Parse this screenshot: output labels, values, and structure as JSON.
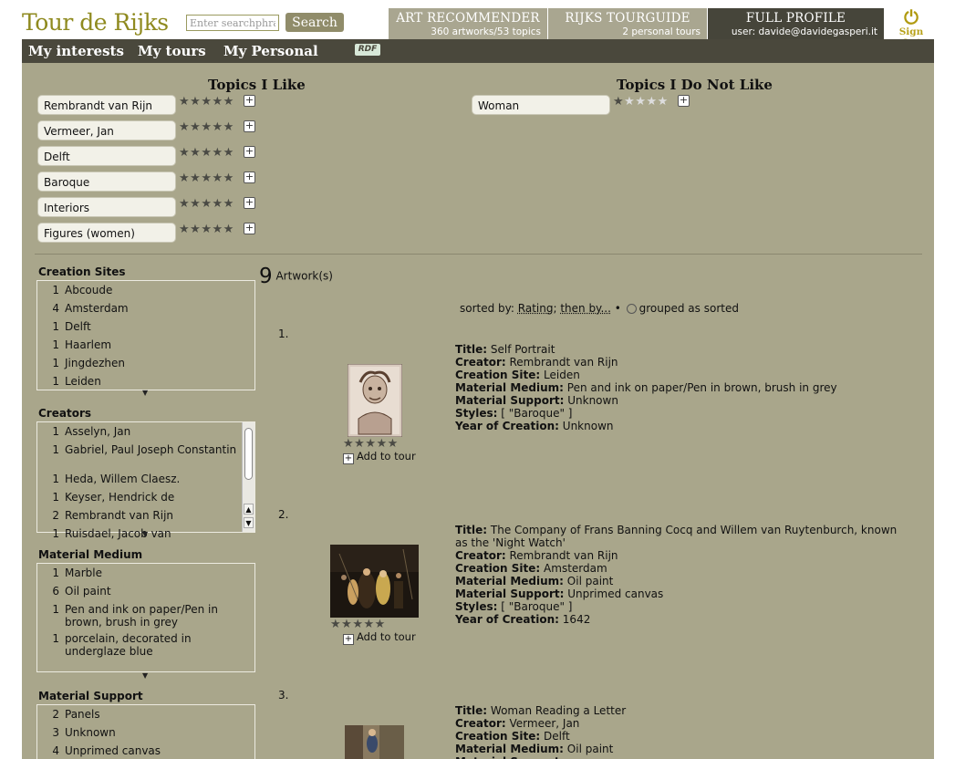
{
  "header": {
    "logo": "Tour de Rijks",
    "search_placeholder": "Enter searchphrase",
    "search_label": "Search",
    "tabs": [
      {
        "title": "ART RECOMMENDER",
        "sub": "360 artworks/53 topics"
      },
      {
        "title": "RIJKS TOURGUIDE",
        "sub": "2 personal tours"
      },
      {
        "title": "FULL PROFILE",
        "sub": "user: davide@davidegasperi.it"
      }
    ],
    "signout": "Sign Out"
  },
  "nav": {
    "items": [
      "My interests",
      "My tours",
      "My Personal"
    ],
    "rdf": "RDF"
  },
  "likes": {
    "title": "Topics I Like",
    "topics": [
      {
        "label": "Rembrandt van Rijn",
        "rating": 5
      },
      {
        "label": "Vermeer, Jan",
        "rating": 5
      },
      {
        "label": "Delft",
        "rating": 5
      },
      {
        "label": "Baroque",
        "rating": 5
      },
      {
        "label": "Interiors",
        "rating": 5
      },
      {
        "label": "Figures (women)",
        "rating": 5
      }
    ]
  },
  "dislikes": {
    "title": "Topics I Do Not Like",
    "topics": [
      {
        "label": "Woman",
        "rating": 1
      }
    ]
  },
  "facets": {
    "creation_sites": {
      "title": "Creation Sites",
      "rows": [
        {
          "n": "1",
          "v": "Abcoude"
        },
        {
          "n": "4",
          "v": "Amsterdam"
        },
        {
          "n": "1",
          "v": "Delft"
        },
        {
          "n": "1",
          "v": "Haarlem"
        },
        {
          "n": "1",
          "v": "Jingdezhen"
        },
        {
          "n": "1",
          "v": "Leiden"
        }
      ]
    },
    "creators": {
      "title": "Creators",
      "rows": [
        {
          "n": "1",
          "v": "Asselyn, Jan"
        },
        {
          "n": "1",
          "v": "Gabriel, Paul Joseph Constantin"
        },
        {
          "n": "1",
          "v": "Heda, Willem Claesz."
        },
        {
          "n": "1",
          "v": "Keyser, Hendrick de"
        },
        {
          "n": "2",
          "v": "Rembrandt van Rijn"
        },
        {
          "n": "1",
          "v": "Ruisdael, Jacob van"
        }
      ]
    },
    "material_medium": {
      "title": "Material Medium",
      "rows": [
        {
          "n": "1",
          "v": "Marble"
        },
        {
          "n": "6",
          "v": "Oil paint"
        },
        {
          "n": "1",
          "v": "Pen and ink on paper/Pen in brown, brush in grey"
        },
        {
          "n": "1",
          "v": "porcelain, decorated in underglaze blue"
        }
      ]
    },
    "material_support": {
      "title": "Material Support",
      "rows": [
        {
          "n": "2",
          "v": "Panels"
        },
        {
          "n": "3",
          "v": "Unknown"
        },
        {
          "n": "4",
          "v": "Unprimed canvas"
        }
      ]
    }
  },
  "results": {
    "count": "9",
    "count_label": "Artwork(s)",
    "sort_prefix": "sorted by:",
    "sort_key": "Rating",
    "sort_then": "then by...",
    "sort_sep": "•",
    "grouped_label": "grouped as sorted",
    "add_to_tour": "Add to tour",
    "labels": {
      "title": "Title:",
      "creator": "Creator:",
      "site": "Creation Site:",
      "medium": "Material Medium:",
      "support": "Material Support:",
      "styles": "Styles:",
      "year": "Year of Creation:"
    },
    "artworks": [
      {
        "num": "1.",
        "title": "Self Portrait",
        "creator": "Rembrandt van Rijn",
        "site": "Leiden",
        "medium": "Pen and ink on paper/Pen in brown, brush in grey",
        "support": "Unknown",
        "styles": "[ \"Baroque\" ]",
        "year": "Unknown"
      },
      {
        "num": "2.",
        "title": "The Company of Frans Banning Cocq and Willem van Ruytenburch, known as the 'Night Watch'",
        "creator": "Rembrandt van Rijn",
        "site": "Amsterdam",
        "medium": "Oil paint",
        "support": "Unprimed canvas",
        "styles": "[ \"Baroque\" ]",
        "year": "1642"
      },
      {
        "num": "3.",
        "title": "Woman Reading a Letter",
        "creator": "Vermeer, Jan",
        "site": "Delft",
        "medium": "Oil paint"
      }
    ]
  },
  "colors": {
    "olive_bg": "#a9a68b",
    "nav_dark": "#4a483c",
    "logo": "#8f8a1f"
  }
}
